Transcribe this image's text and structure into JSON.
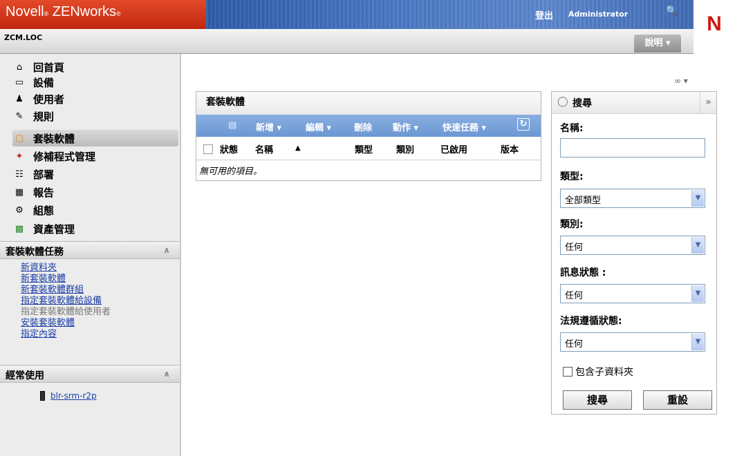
{
  "header": {
    "brand_name": "Novell",
    "brand_product": "ZENworks",
    "brand_mark": "®",
    "logout_label": "登出",
    "user": "Administrator",
    "zone": "ZCM.LOC",
    "help_label": "說明 ▾",
    "logo_letter": "N"
  },
  "nav": {
    "items": [
      {
        "label": "回首頁",
        "icon": "home-icon"
      },
      {
        "label": "設備",
        "icon": "monitor-icon"
      },
      {
        "label": "使用者",
        "icon": "user-icon"
      },
      {
        "label": "規則",
        "icon": "policy-icon"
      },
      {
        "label": "套裝軟體",
        "icon": "bundle-icon"
      },
      {
        "label": "修補程式管理",
        "icon": "patch-icon"
      },
      {
        "label": "部署",
        "icon": "deployment-icon"
      },
      {
        "label": "報告",
        "icon": "report-icon"
      },
      {
        "label": "組態",
        "icon": "configuration-icon"
      },
      {
        "label": "資產管理",
        "icon": "asset-management-icon"
      }
    ],
    "selected": "套裝軟體"
  },
  "tasks": {
    "title": "套裝軟體任務",
    "links": [
      {
        "label": "新資料夾",
        "enabled": true
      },
      {
        "label": "新套裝軟體",
        "enabled": true
      },
      {
        "label": "新套裝軟體群組",
        "enabled": true
      },
      {
        "label": "指定套裝軟體給設備",
        "enabled": true
      },
      {
        "label": "指定套裝軟體給使用者",
        "enabled": false
      },
      {
        "label": "安裝套裝軟體",
        "enabled": true
      },
      {
        "label": "指定內容",
        "enabled": true
      }
    ]
  },
  "recent": {
    "title": "經常使用",
    "items": [
      {
        "label": "blr-srm-r2p",
        "icon": "server-icon"
      }
    ]
  },
  "bundles": {
    "title": "套裝軟體",
    "toolbar": {
      "new_label": "新增 ▾",
      "edit_label": "編輯 ▾",
      "delete_label": "刪除",
      "action_label": "動作 ▾",
      "quick_tasks_label": "快速任務 ▾"
    },
    "columns": [
      "狀態",
      "名稱",
      "類型",
      "類別",
      "已啟用",
      "版本"
    ],
    "sort_indicator": "▲",
    "empty_text": "無可用的項目。"
  },
  "search": {
    "title": "搜尋",
    "name_label": "名稱:",
    "name_value": "",
    "type_label": "類型:",
    "type_value": "全部類型",
    "category_label": "類別:",
    "category_value": "任何",
    "message_label": "訊息狀態 :",
    "message_value": "任何",
    "compliance_label": "法規遵循狀態:",
    "compliance_value": "任何",
    "include_subfolders_label": "包含子資料夾",
    "include_subfolders_checked": false,
    "search_button": "搜尋",
    "reset_button": "重設"
  }
}
